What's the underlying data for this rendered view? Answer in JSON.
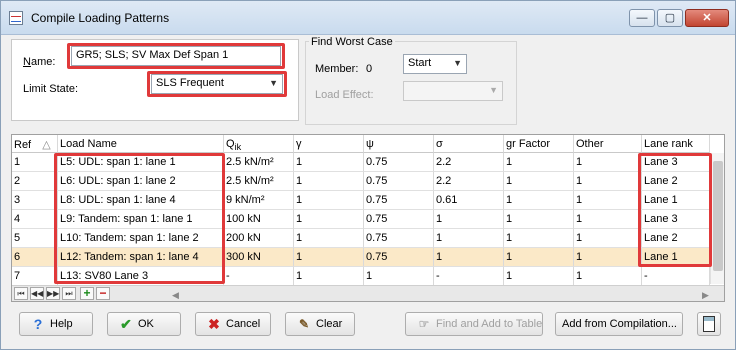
{
  "window": {
    "title": "Compile Loading Patterns",
    "controls": {
      "minimize": "—",
      "maximize": "▢",
      "close": "✕"
    }
  },
  "form": {
    "name_label": "Name:",
    "name_value": "GR5; SLS; SV Max Def Span 1",
    "limit_state_label": "Limit State:",
    "limit_state_value": "SLS Frequent"
  },
  "find_worst": {
    "title": "Find Worst Case",
    "member_label": "Member:",
    "member_value": "0",
    "start_value": "Start",
    "load_effect_label": "Load Effect:",
    "load_effect_value": ""
  },
  "grid": {
    "columns": [
      "Ref",
      "Load Name",
      "Qik",
      "γ",
      "ψ",
      "σ",
      "gr Factor",
      "Other",
      "Lane rank"
    ],
    "sort_indicator": "△",
    "rows": [
      {
        "ref": "1",
        "name": "L5: UDL: span 1: lane 1",
        "q": "2.5 kN/m²",
        "gamma": "1",
        "psi": "0.75",
        "sigma": "2.2",
        "gr": "1",
        "other": "1",
        "lane": "Lane 3"
      },
      {
        "ref": "2",
        "name": "L6: UDL: span 1: lane 2",
        "q": "2.5 kN/m²",
        "gamma": "1",
        "psi": "0.75",
        "sigma": "2.2",
        "gr": "1",
        "other": "1",
        "lane": "Lane 2"
      },
      {
        "ref": "3",
        "name": "L8: UDL: span 1: lane 4",
        "q": "9 kN/m²",
        "gamma": "1",
        "psi": "0.75",
        "sigma": "0.61",
        "gr": "1",
        "other": "1",
        "lane": "Lane 1"
      },
      {
        "ref": "4",
        "name": "L9: Tandem: span 1: lane 1",
        "q": "100 kN",
        "gamma": "1",
        "psi": "0.75",
        "sigma": "1",
        "gr": "1",
        "other": "1",
        "lane": "Lane 3"
      },
      {
        "ref": "5",
        "name": "L10: Tandem: span 1: lane 2",
        "q": "200 kN",
        "gamma": "1",
        "psi": "0.75",
        "sigma": "1",
        "gr": "1",
        "other": "1",
        "lane": "Lane 2"
      },
      {
        "ref": "6",
        "name": "L12: Tandem: span 1: lane 4",
        "q": "300 kN",
        "gamma": "1",
        "psi": "0.75",
        "sigma": "1",
        "gr": "1",
        "other": "1",
        "lane": "Lane 1"
      },
      {
        "ref": "7",
        "name": "L13: SV80 Lane 3",
        "q": "-",
        "gamma": "1",
        "psi": "1",
        "sigma": "-",
        "gr": "1",
        "other": "1",
        "lane": "-"
      }
    ],
    "nav": {
      "first": "⏮",
      "prev": "◀◀",
      "next": "▶▶",
      "last": "⏭",
      "add": "+",
      "remove": "−"
    }
  },
  "buttons": {
    "help": "Help",
    "ok": "OK",
    "cancel": "Cancel",
    "clear": "Clear",
    "find_add": "Find and Add to Table",
    "add_from_compilation": "Add from Compilation..."
  },
  "colors": {
    "highlight_box": "#e0393a",
    "selected_row": "#fbe9c8",
    "help_icon": "#2a6fd6",
    "ok_icon": "#2a9a2a",
    "cancel_icon": "#cc2222"
  }
}
